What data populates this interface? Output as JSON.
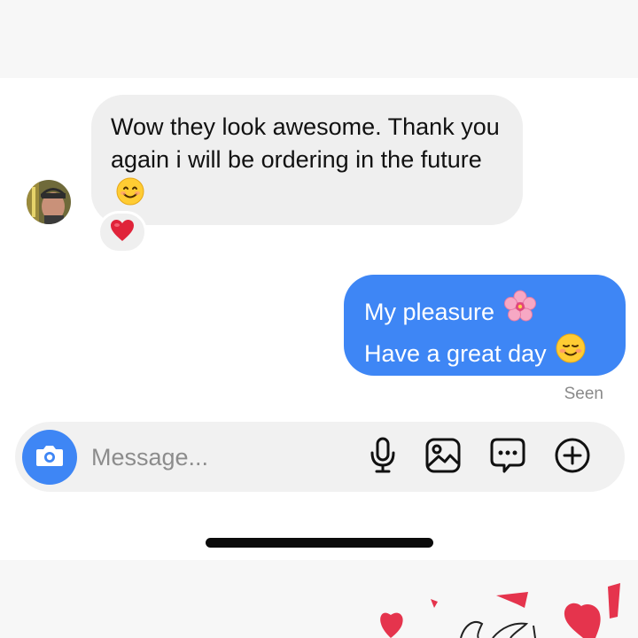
{
  "thread": {
    "incoming": {
      "text": "Wow they look awesome.  Thank you again i will be ordering in the future",
      "emoji": "smiling-face-icon",
      "reaction": "heart-icon"
    },
    "outgoing": {
      "line1": "My pleasure",
      "line1_emoji": "cherry-blossom-icon",
      "line2": "Have a great day",
      "line2_emoji": "smiling-relaxed-face-icon"
    },
    "status": "Seen"
  },
  "composer": {
    "placeholder": "Message...",
    "tools": [
      "camera-icon",
      "microphone-icon",
      "gallery-icon",
      "chat-bubble-icon",
      "add-icon"
    ]
  },
  "colors": {
    "accent": "#3e86f5",
    "incoming_bubble": "#efefef",
    "heart": "#e0243a"
  }
}
